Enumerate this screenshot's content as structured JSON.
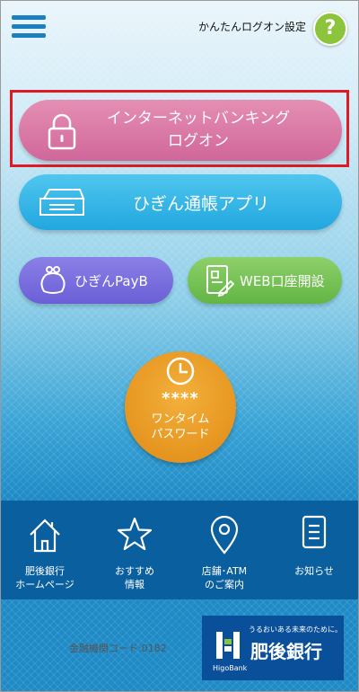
{
  "header": {
    "easy_logon_label": "かんたんログオン設定",
    "help_label": "?"
  },
  "buttons": {
    "logon_line1": "インターネットバンキング",
    "logon_line2": "ログオン",
    "passbook_label": "ひぎん通帳アプリ",
    "payb_label": "ひぎんPayB",
    "web_account_label": "WEB口座開設"
  },
  "otp": {
    "stars": "****",
    "line1": "ワンタイム",
    "line2": "パスワード"
  },
  "bottom_nav": [
    {
      "line1": "肥後銀行",
      "line2": "ホームページ",
      "icon": "home-icon"
    },
    {
      "line1": "おすすめ",
      "line2": "情報",
      "icon": "star-icon"
    },
    {
      "line1": "店舗･ATM",
      "line2": "のご案内",
      "icon": "location-pin-icon"
    },
    {
      "line1": "お知らせ",
      "line2": "",
      "icon": "notice-icon"
    }
  ],
  "footer": {
    "bank_code": "金融機関コード:0182",
    "logo_tagline": "うるおいある未来のために。",
    "logo_name": "肥後銀行",
    "logo_en": "HigoBank"
  },
  "colors": {
    "highlight_border": "#e01a22",
    "logon_pink": "#d0679a",
    "passbook_blue": "#22a7df",
    "payb_purple": "#6b5fd6",
    "web_green": "#62b544",
    "otp_orange": "#e08a14",
    "nav_blue": "#0a5f9e",
    "logo_blue": "#0a4f99"
  }
}
